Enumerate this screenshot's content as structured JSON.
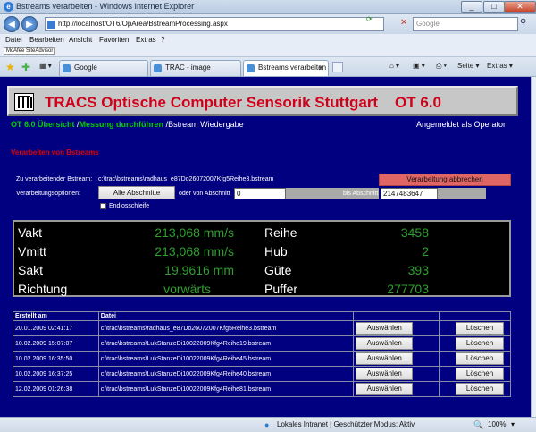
{
  "window": {
    "title": "Bstreams verarbeiten - Windows Internet Explorer"
  },
  "address": {
    "url": "http://localhost/OT6/OpArea/BstreamProcessing.aspx",
    "search_placeholder": "Google"
  },
  "menu": [
    "Datei",
    "Bearbeiten",
    "Ansicht",
    "Favoriten",
    "Extras",
    "?"
  ],
  "links": {
    "mcafee": "McAfee SiteAdvisor"
  },
  "tabs": [
    {
      "label": "Google",
      "active": false
    },
    {
      "label": "TRAC - image processi...",
      "active": false
    },
    {
      "label": "Bstreams verarbeiten",
      "active": true
    }
  ],
  "toolbar": {
    "page": "Seite",
    "extras": "Extras"
  },
  "banner": {
    "title": "TRACS Optische Computer Sensorik Stuttgart    OT 6.0"
  },
  "nav": {
    "overview": "OT 6.0 Übersicht",
    "sep1": " /",
    "measure": "Messung durchführen",
    "sep2": " /",
    "current": "Bstream Wiedergabe",
    "login": "Angemeldet als Operator"
  },
  "section": {
    "title": "Verarbeiten von Bstreams"
  },
  "form": {
    "stream_label": "Zu verarbeitender Bstream:",
    "stream_path": "c:\\trac\\bstreams\\radhaus_e87Do26072007Kfg5Reihe3.bstream",
    "stop_button": "Verarbeitung abbrechen",
    "options_label": "Verarbeitungsoptionen:",
    "all_sections_button": "Alle Abschnitte",
    "from_label": "oder von Abschnitt",
    "from_value": "0",
    "to_label": "bis Abschnitt",
    "to_value": "2147483647",
    "loop_label": "Endlosschleife"
  },
  "stats": {
    "vakt": {
      "label": "Vakt",
      "value": "213,068 mm/s"
    },
    "vmitt": {
      "label": "Vmitt",
      "value": "213,068 mm/s"
    },
    "sakt": {
      "label": "Sakt",
      "value": "19,9616 mm"
    },
    "richtung": {
      "label": "Richtung",
      "value": "vorwärts"
    },
    "reihe": {
      "label": "Reihe",
      "value": "3458"
    },
    "hub": {
      "label": "Hub",
      "value": "2"
    },
    "guete": {
      "label": "Güte",
      "value": "393"
    },
    "puffer": {
      "label": "Puffer",
      "value": "277703"
    }
  },
  "table": {
    "headers": [
      "Erstellt am",
      "Datei",
      "",
      ""
    ],
    "select_label": "Auswählen",
    "delete_label": "Löschen",
    "rows": [
      {
        "date": "20.01.2009 02:41:17",
        "file": "c:\\trac\\bstreams\\radhaus_e87Do26072007Kfg5Reihe3.bstream"
      },
      {
        "date": "10.02.2009 15:07:07",
        "file": "c:\\trac\\bstreams\\LukStanzeDi10022009Kfg4Reihe19.bstream"
      },
      {
        "date": "10.02.2009 16:35:50",
        "file": "c:\\trac\\bstreams\\LukStanzeDi10022009Kfg4Reihe45.bstream"
      },
      {
        "date": "10.02.2009 16:37:25",
        "file": "c:\\trac\\bstreams\\LukStanzeDi10022009Kfg4Reihe40.bstream"
      },
      {
        "date": "12.02.2009 01:26:38",
        "file": "c:\\trac\\bstreams\\LukStanzeDi10022009Kfg4Reihe81.bstream"
      }
    ]
  },
  "status": {
    "zone": "Lokales Intranet | Geschützter Modus: Aktiv",
    "zoom": "100%"
  }
}
